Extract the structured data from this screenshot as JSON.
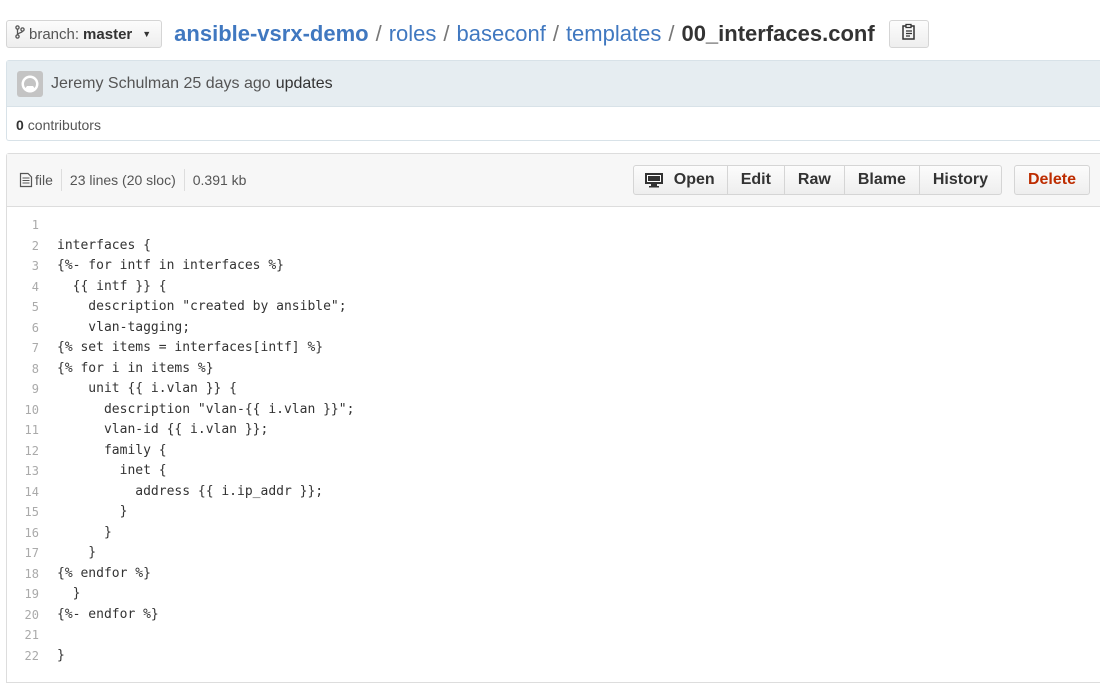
{
  "branch": {
    "prefix": "branch:",
    "name": "master"
  },
  "breadcrumb": {
    "repo": "ansible-vsrx-demo",
    "dirs": [
      "roles",
      "baseconf",
      "templates"
    ],
    "separator": "/",
    "file": "00_interfaces.conf"
  },
  "commit": {
    "author": "Jeremy Schulman",
    "time": "25 days ago",
    "message": "updates",
    "contributors_count": "0",
    "contributors_label": "contributors"
  },
  "file_header": {
    "file_label": "file",
    "lines": "23 lines (20 sloc)",
    "size": "0.391 kb"
  },
  "actions": {
    "open": "Open",
    "edit": "Edit",
    "raw": "Raw",
    "blame": "Blame",
    "history": "History",
    "delete": "Delete"
  },
  "colors": {
    "link": "#4078c0",
    "delete": "#bd2c00",
    "commit_bg": "#e6edf1"
  },
  "code_lines": [
    "",
    "interfaces {",
    "{%- for intf in interfaces %}",
    "  {{ intf }} {",
    "    description \"created by ansible\";",
    "    vlan-tagging;",
    "{% set items = interfaces[intf] %}",
    "{% for i in items %}",
    "    unit {{ i.vlan }} {",
    "      description \"vlan-{{ i.vlan }}\";",
    "      vlan-id {{ i.vlan }};",
    "      family {",
    "        inet {",
    "          address {{ i.ip_addr }};",
    "        }",
    "      }",
    "    }",
    "{% endfor %}",
    "  }",
    "{%- endfor %}",
    "",
    "}"
  ]
}
